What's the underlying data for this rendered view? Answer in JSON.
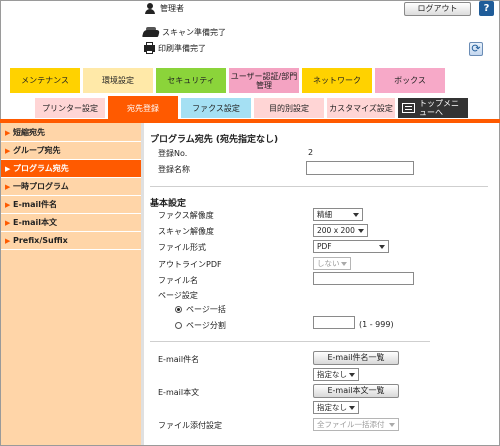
{
  "header": {
    "user": "管理者",
    "logout_label": "ログアウト",
    "help_label": "?",
    "status": [
      "スキャン準備完了",
      "印刷準備完了"
    ]
  },
  "tabs": [
    {
      "label": "メンテナンス",
      "color": "#ffd200"
    },
    {
      "label": "環境設定",
      "color": "#ffe9a8"
    },
    {
      "label": "セキュリティ",
      "color": "#8bd43a"
    },
    {
      "label": "ユーザー認証/部門管理",
      "color": "#f4a3c2"
    },
    {
      "label": "ネットワーク",
      "color": "#ffd200"
    },
    {
      "label": "ボックス",
      "color": "#f7a9c8"
    }
  ],
  "subtabs": [
    {
      "label": "プリンター設定",
      "color": "#ffd5d5"
    },
    {
      "label": "宛先登録",
      "color": "#ff5a00"
    },
    {
      "label": "ファクス設定",
      "color": "#a5e0f3"
    },
    {
      "label": "目的別設定",
      "color": "#ffd5d5"
    },
    {
      "label": "カスタマイズ設定",
      "color": "#ffd5d5"
    },
    {
      "label": "トップメニューへ",
      "color": "#333333"
    }
  ],
  "sidebar": {
    "items": [
      "短縮宛先",
      "グループ宛先",
      "プログラム宛先",
      "一時プログラム",
      "E-mail件名",
      "E-mail本文",
      "Prefix/Suffix"
    ]
  },
  "main": {
    "title": "プログラム宛先 (宛先指定なし)",
    "reg_no_label": "登録No.",
    "reg_no_value": "2",
    "reg_name_label": "登録名称",
    "reg_name_value": "",
    "basic_title": "基本設定",
    "fax_res_label": "ファクス解像度",
    "fax_res_value": "精細",
    "scan_res_label": "スキャン解像度",
    "scan_res_value": "200 x 200",
    "file_format_label": "ファイル形式",
    "file_format_value": "PDF",
    "outline_label": "アウトラインPDF",
    "outline_value": "しない",
    "file_name_label": "ファイル名",
    "file_name_value": "",
    "page_setting_label": "ページ設定",
    "page_all_label": "ページ一括",
    "page_split_label": "ページ分割",
    "page_split_value": "",
    "page_split_range": "(1 - 999)",
    "email_subject_label": "E-mail件名",
    "email_subject_button": "E-mail件名一覧",
    "email_subject_value": "指定なし",
    "email_body_label": "E-mail本文",
    "email_body_button": "E-mail本文一覧",
    "email_body_value": "指定なし",
    "attach_label": "ファイル添付設定",
    "attach_value": "全ファイル一括添付"
  }
}
